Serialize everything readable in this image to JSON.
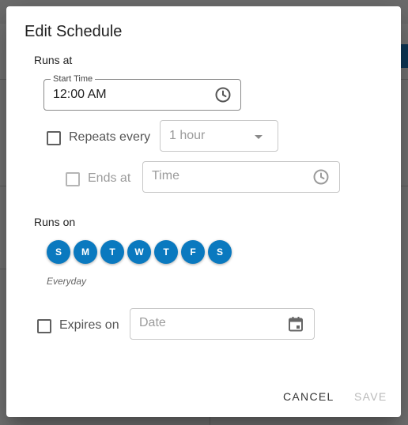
{
  "dialog": {
    "title": "Edit Schedule",
    "runs_at_label": "Runs at",
    "start_time": {
      "label": "Start Time",
      "value": "12:00 AM",
      "icon": "clock-icon"
    },
    "repeats": {
      "label": "Repeats every",
      "checked": false,
      "interval": "1 hour"
    },
    "ends": {
      "label": "Ends at",
      "checked": false,
      "placeholder": "Time",
      "icon": "clock-icon"
    },
    "runs_on_label": "Runs on",
    "days": [
      "S",
      "M",
      "T",
      "W",
      "T",
      "F",
      "S"
    ],
    "days_summary": "Everyday",
    "expires": {
      "label": "Expires on",
      "checked": false,
      "placeholder": "Date",
      "icon": "calendar-icon"
    },
    "actions": {
      "cancel": "CANCEL",
      "save": "SAVE"
    }
  },
  "colors": {
    "accent": "#0a79bf",
    "scrim": "rgba(0,0,0,0.55)"
  }
}
